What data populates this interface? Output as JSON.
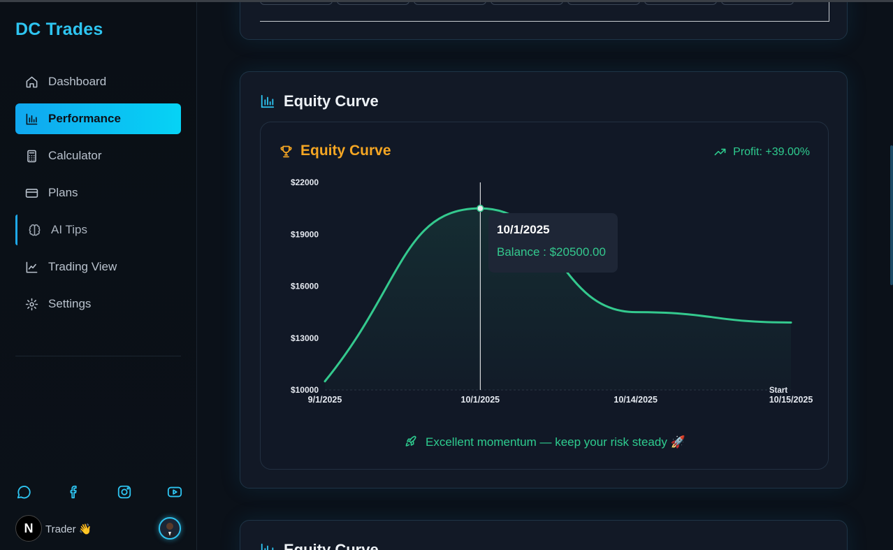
{
  "app": {
    "brand": "DC Trades"
  },
  "sidebar": {
    "items": [
      {
        "label": "Dashboard",
        "icon": "home-icon",
        "active": false
      },
      {
        "label": "Performance",
        "icon": "bar-chart-icon",
        "active": true
      },
      {
        "label": "Calculator",
        "icon": "calculator-icon",
        "active": false
      },
      {
        "label": "Plans",
        "icon": "credit-card-icon",
        "active": false
      },
      {
        "label": "AI Tips",
        "icon": "brain-icon",
        "active": false
      },
      {
        "label": "Trading View",
        "icon": "line-chart-icon",
        "active": false
      },
      {
        "label": "Settings",
        "icon": "gear-icon",
        "active": false
      }
    ],
    "socials": [
      "whatsapp-icon",
      "facebook-icon",
      "instagram-icon",
      "youtube-icon"
    ],
    "user": {
      "logo_letter": "N",
      "name": "Trader 👋"
    }
  },
  "section": {
    "title": "Equity Curve",
    "next_title": "Equity Curve"
  },
  "card": {
    "title": "Equity Curve",
    "profit_label": "Profit: +39.00%",
    "momentum": "Excellent momentum — keep your risk steady 🚀"
  },
  "tooltip": {
    "date": "10/1/2025",
    "balance": "Balance : $20500.00"
  },
  "colors": {
    "accent": "#2ec4f0",
    "active_nav": "#06d3f5",
    "line": "#34c98e",
    "trophy": "#f5a623",
    "profit": "#2ecc8f"
  },
  "chart_data": {
    "type": "line",
    "x": [
      "9/1/2025",
      "10/1/2025",
      "10/14/2025",
      "10/15/2025"
    ],
    "series": [
      {
        "values": [
          10500,
          20500,
          14500,
          13900
        ]
      }
    ],
    "ylim": [
      10000,
      22000
    ],
    "y_ticks": [
      "$22000",
      "$19000",
      "$16000",
      "$13000",
      "$10000"
    ],
    "x_tick_labels": [
      "9/1/2025",
      "10/1/2025",
      "10/14/2025",
      "10/15/2025"
    ],
    "extra_label": "Start",
    "highlighted_index": 1
  }
}
